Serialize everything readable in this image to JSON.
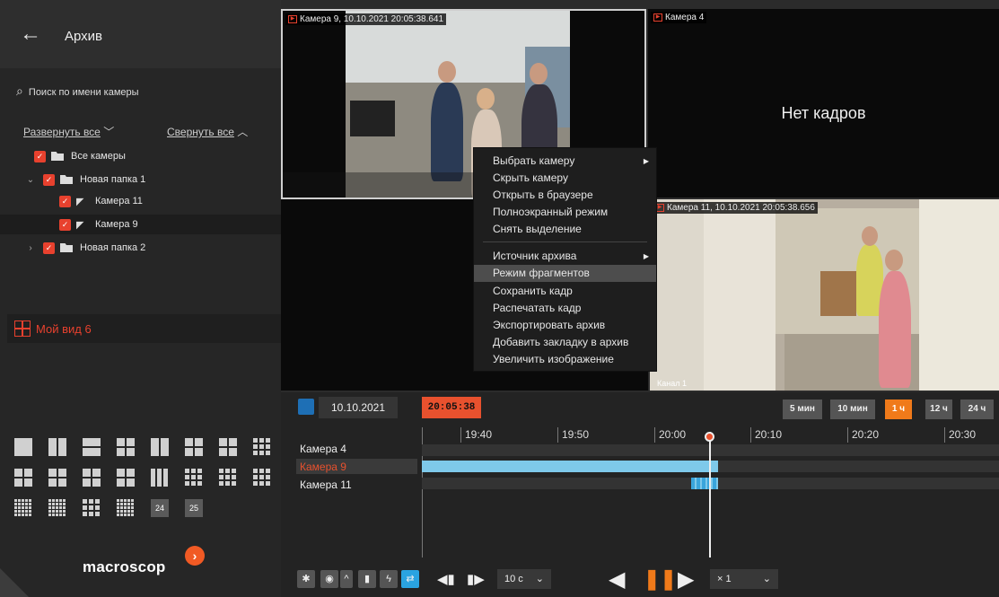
{
  "sidebar": {
    "title": "Архив",
    "search_placeholder": "Поиск по имени камеры",
    "expand_all": "Развернуть все",
    "collapse_all": "Свернуть все",
    "tree": [
      {
        "label": "Все камеры"
      },
      {
        "label": "Новая папка 1"
      },
      {
        "label": "Камера 11"
      },
      {
        "label": "Камера 9"
      },
      {
        "label": "Новая папка 2"
      }
    ],
    "view_name": "Мой вид 6",
    "layout_numbers": [
      "24",
      "25"
    ],
    "logo": "macroscop"
  },
  "cells": {
    "cam9": {
      "label": "Камера 9, 10.10.2021 20:05:38.641"
    },
    "cam4": {
      "label": "Камера 4",
      "no_frames": "Нет кадров"
    },
    "cam11": {
      "label": "Камера 11, 10.10.2021 20:05:38.656",
      "channel": "Канал 1"
    }
  },
  "context_menu": {
    "items": [
      {
        "label": "Выбрать камеру",
        "submenu": true
      },
      {
        "label": "Скрыть камеру"
      },
      {
        "label": "Открыть в браузере"
      },
      {
        "label": "Полноэкранный режим"
      },
      {
        "label": "Снять выделение"
      },
      {
        "label": "Источник архива",
        "submenu": true
      },
      {
        "label": "Режим фрагментов",
        "highlighted": true
      },
      {
        "label": "Сохранить кадр"
      },
      {
        "label": "Распечатать кадр"
      },
      {
        "label": "Экспортировать архив"
      },
      {
        "label": "Добавить закладку в архив"
      },
      {
        "label": "Увеличить изображение"
      }
    ]
  },
  "timeline": {
    "date": "10.10.2021",
    "current_time": "20:05:38",
    "zoom_options": [
      {
        "label": "5 мин",
        "active": false
      },
      {
        "label": "10 мин",
        "active": false
      },
      {
        "label": "1 ч",
        "active": true
      },
      {
        "label": "12 ч",
        "active": false
      },
      {
        "label": "24 ч",
        "active": false
      }
    ],
    "ruler": [
      "19:40",
      "19:50",
      "20:00",
      "20:10",
      "20:20",
      "20:30"
    ],
    "tracks": [
      {
        "name": "Камера 4",
        "selected": false
      },
      {
        "name": "Камера 9",
        "selected": true
      },
      {
        "name": "Камера 11",
        "selected": false
      }
    ],
    "step": "10 с",
    "speed": "× 1"
  },
  "colors": {
    "accent": "#e8412e",
    "timeline_fill": "#7ec9ea",
    "zoom_active": "#f07a1a"
  }
}
